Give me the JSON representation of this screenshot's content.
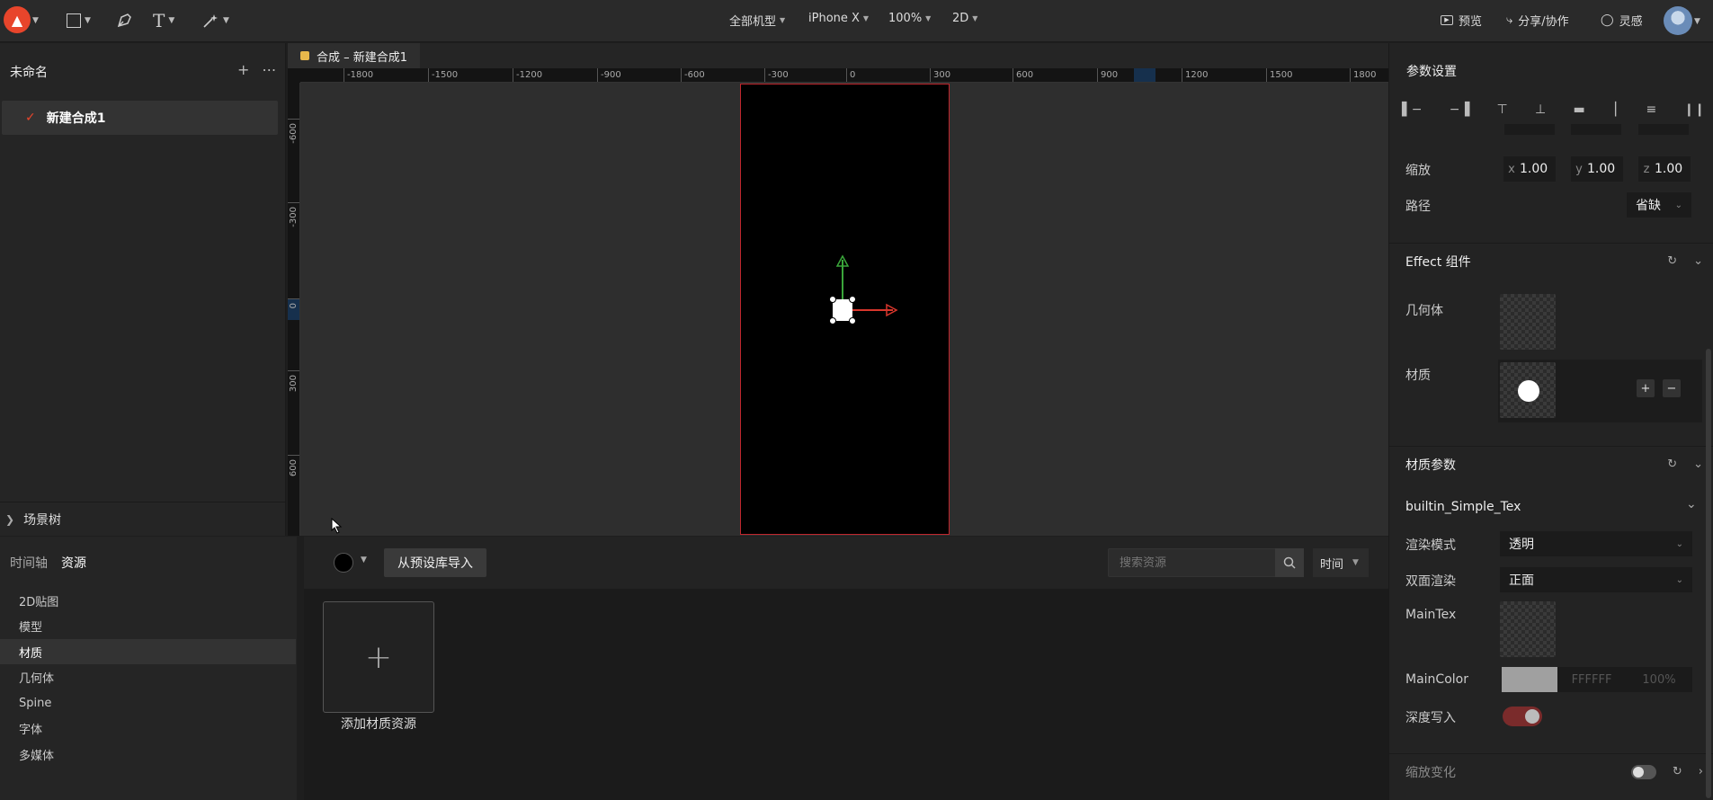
{
  "topbar": {
    "device_filter": "全部机型",
    "device": "iPhone X",
    "zoom": "100%",
    "mode": "2D",
    "preview_label": "预览",
    "share_label": "分享/协作",
    "inspiration_label": "灵感"
  },
  "left": {
    "project_title": "未命名",
    "composition_item": "新建合成1",
    "scene_tree_label": "场景树"
  },
  "doc_tab": {
    "label": "合成 – 新建合成1"
  },
  "rulers": {
    "h": [
      "-1800",
      "-1500",
      "-1200",
      "-900",
      "-600",
      "-300",
      "0",
      "300",
      "600",
      "900",
      "1200",
      "1500",
      "1800"
    ],
    "v": [
      "-600",
      "-300",
      "0",
      "300",
      "600"
    ]
  },
  "bottom": {
    "tab_timeline": "时间轴",
    "tab_resources": "资源",
    "resource_types": [
      "2D贴图",
      "模型",
      "材质",
      "几何体",
      "Spine",
      "字体",
      "多媒体"
    ],
    "active_type": "材质",
    "import_label": "从预设库导入",
    "search_placeholder": "搜索资源",
    "sort_label": "时间",
    "add_material_label": "添加材质资源"
  },
  "right": {
    "title": "参数设置",
    "scale_label": "缩放",
    "scale": {
      "x": "1.00",
      "y": "1.00",
      "z": "1.00"
    },
    "axis_x": "x",
    "axis_y": "y",
    "axis_z": "z",
    "path_label": "路径",
    "path_value": "省缺",
    "effect_section": "Effect 组件",
    "geometry_label": "几何体",
    "material_label": "材质",
    "material_params_section": "材质参数",
    "shader_name": "builtin_Simple_Tex",
    "render_mode_label": "渲染模式",
    "render_mode_value": "透明",
    "double_side_label": "双面渲染",
    "double_side_value": "正面",
    "maintex_label": "MainTex",
    "maincolor_label": "MainColor",
    "maincolor_hex": "FFFFFF",
    "maincolor_alpha": "100%",
    "depth_write_label": "深度写入",
    "scale_change_label": "缩放变化"
  },
  "colors": {
    "accent": "#e8452b",
    "stage_border": "#c0262d",
    "gizmo_y": "#3aa63a",
    "gizmo_x": "#d8362c"
  }
}
